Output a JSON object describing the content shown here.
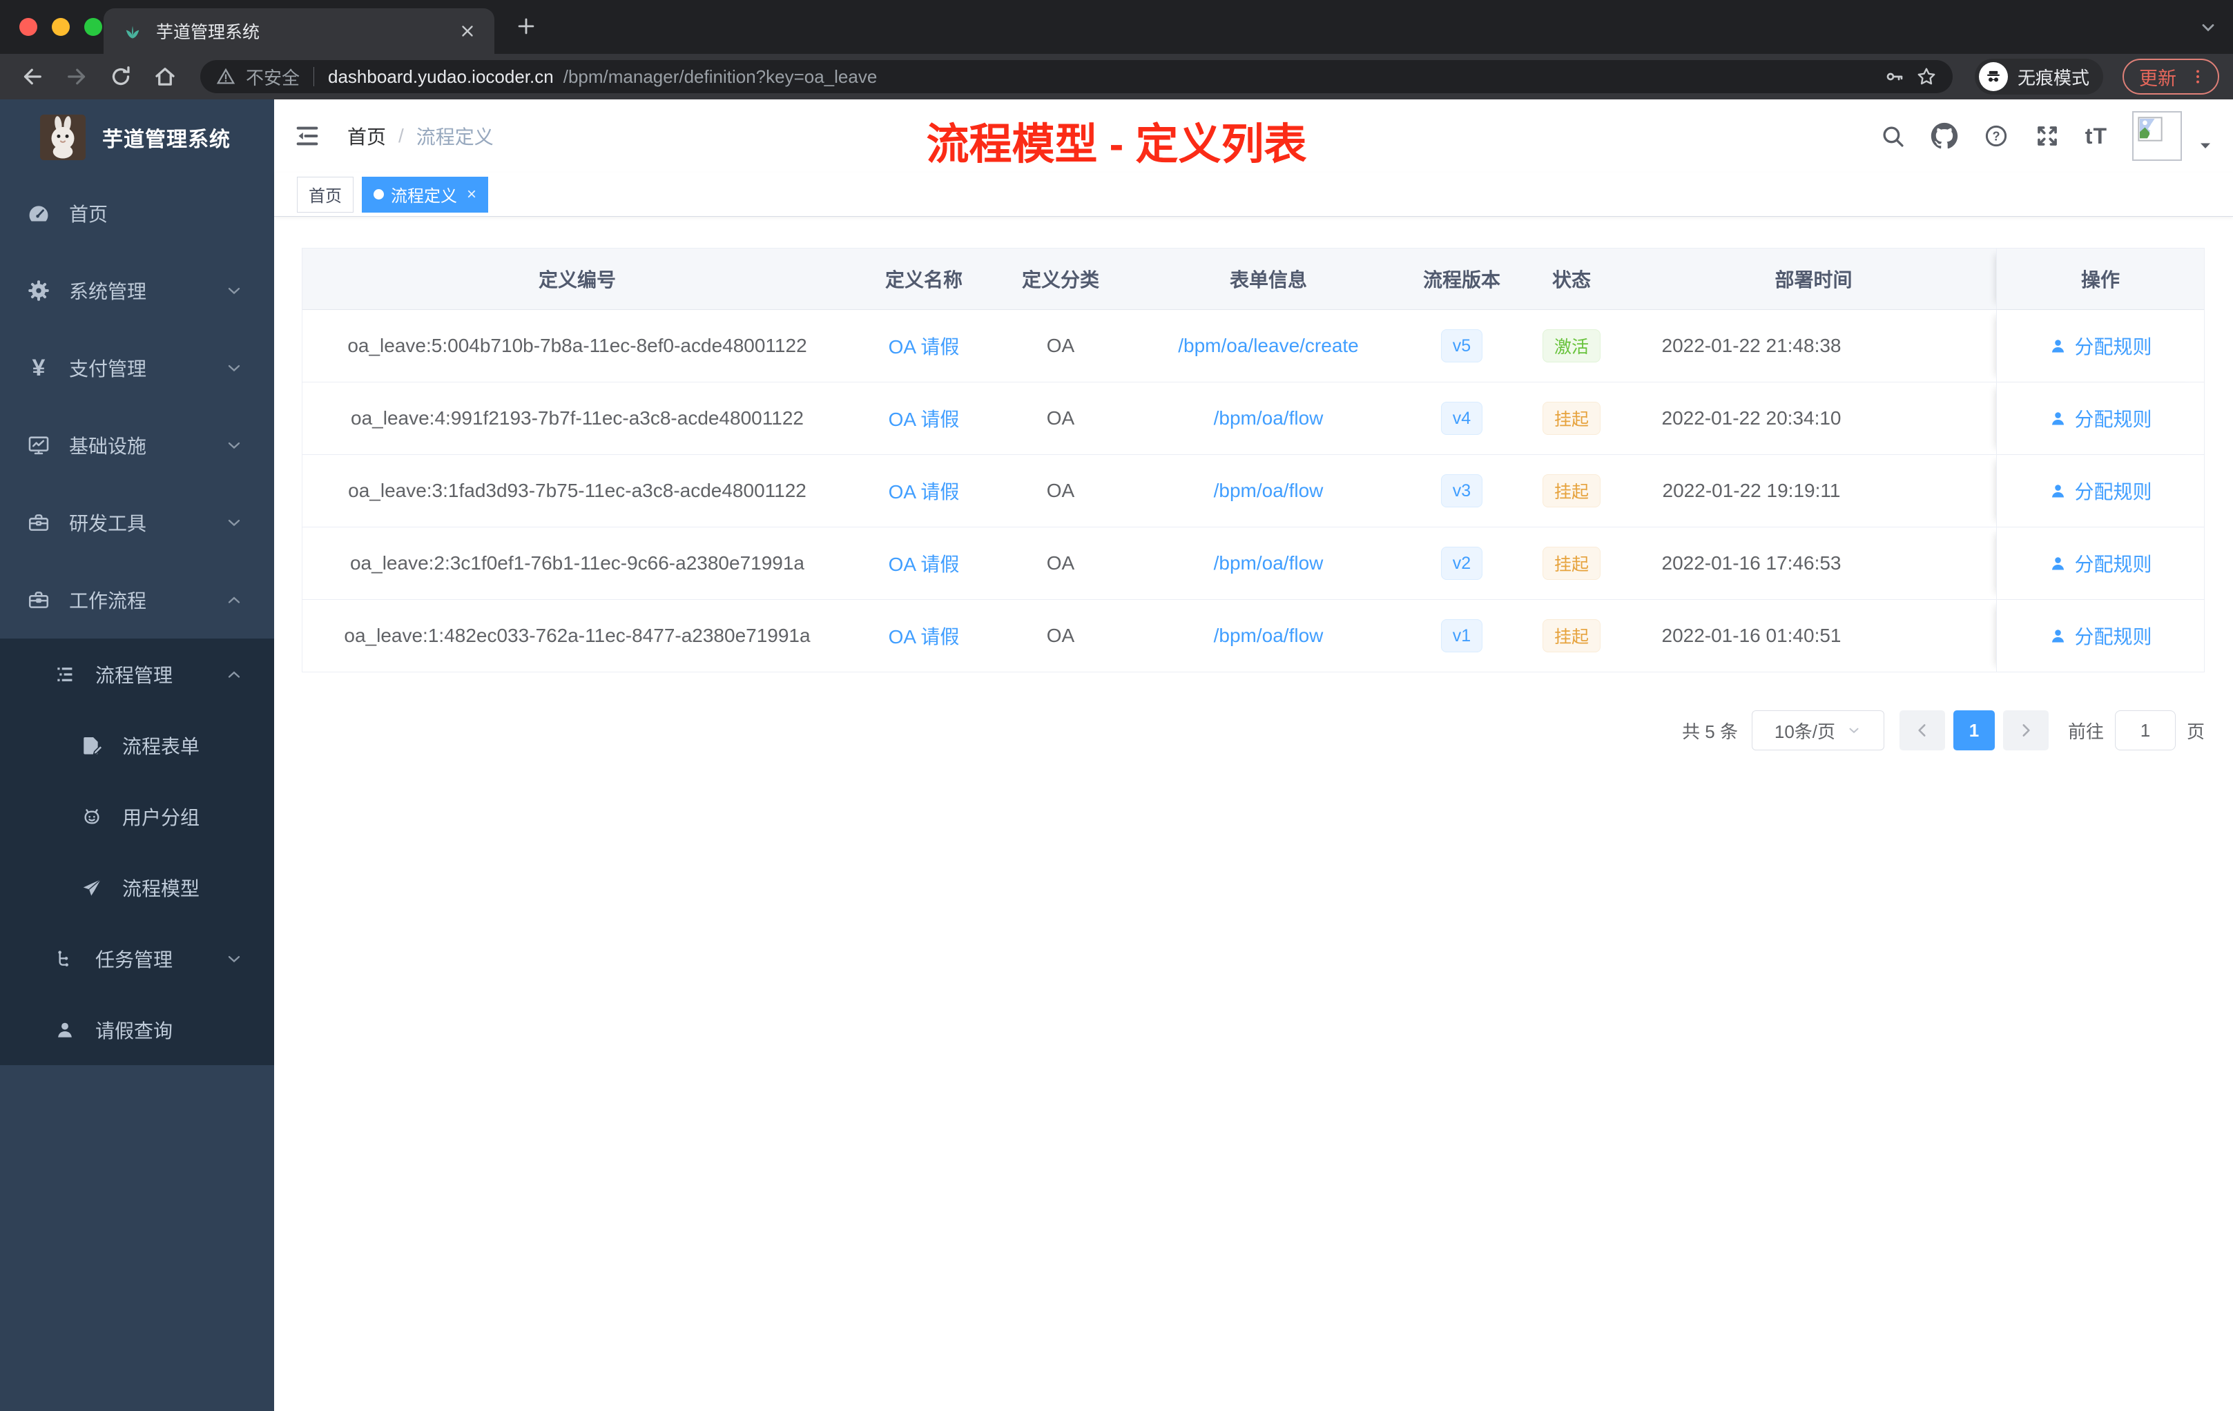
{
  "browser": {
    "tab": {
      "title": "芋道管理系统",
      "favicon": "sprout-icon"
    },
    "address": {
      "security_label": "不安全",
      "domain": "dashboard.yudao.iocoder.cn",
      "path": "/bpm/manager/definition?key=oa_leave"
    },
    "incognito_label": "无痕模式",
    "update_label": "更新"
  },
  "sidebar": {
    "logo_title": "芋道管理系统",
    "menu": [
      {
        "label": "首页",
        "icon": "dashboard-icon",
        "level": 1
      },
      {
        "label": "系统管理",
        "icon": "gear-icon",
        "level": 1,
        "arrow": "down"
      },
      {
        "label": "支付管理",
        "icon": "yen-icon",
        "level": 1,
        "arrow": "down"
      },
      {
        "label": "基础设施",
        "icon": "monitor-icon",
        "level": 1,
        "arrow": "down"
      },
      {
        "label": "研发工具",
        "icon": "toolbox-icon",
        "level": 1,
        "arrow": "down"
      },
      {
        "label": "工作流程",
        "icon": "briefcase-icon",
        "level": 1,
        "arrow": "up"
      },
      {
        "label": "流程管理",
        "icon": "list-tree-icon",
        "level": 2,
        "arrow": "up"
      },
      {
        "label": "流程表单",
        "icon": "form-icon",
        "level": 3
      },
      {
        "label": "用户分组",
        "icon": "robot-icon",
        "level": 3
      },
      {
        "label": "流程模型",
        "icon": "paper-plane-icon",
        "level": 3
      },
      {
        "label": "任务管理",
        "icon": "tree-icon",
        "level": 2,
        "arrow": "down"
      },
      {
        "label": "请假查询",
        "icon": "user-icon",
        "level": 2
      }
    ]
  },
  "header": {
    "breadcrumb_home": "首页",
    "breadcrumb_current": "流程定义",
    "annotation": "流程模型 - 定义列表"
  },
  "tags": {
    "home": "首页",
    "active": "流程定义"
  },
  "table": {
    "columns": {
      "id": "定义编号",
      "name": "定义名称",
      "category": "定义分类",
      "form": "表单信息",
      "version": "流程版本",
      "status": "状态",
      "deploy_time": "部署时间",
      "actions": "操作"
    },
    "rows": [
      {
        "id": "oa_leave:5:004b710b-7b8a-11ec-8ef0-acde48001122",
        "name": "OA 请假",
        "category": "OA",
        "form": "/bpm/oa/leave/create",
        "version": "v5",
        "status": "激活",
        "deploy_time": "2022-01-22 21:48:38",
        "action": "分配规则"
      },
      {
        "id": "oa_leave:4:991f2193-7b7f-11ec-a3c8-acde48001122",
        "name": "OA 请假",
        "category": "OA",
        "form": "/bpm/oa/flow",
        "version": "v4",
        "status": "挂起",
        "deploy_time": "2022-01-22 20:34:10",
        "action": "分配规则"
      },
      {
        "id": "oa_leave:3:1fad3d93-7b75-11ec-a3c8-acde48001122",
        "name": "OA 请假",
        "category": "OA",
        "form": "/bpm/oa/flow",
        "version": "v3",
        "status": "挂起",
        "deploy_time": "2022-01-22 19:19:11",
        "action": "分配规则"
      },
      {
        "id": "oa_leave:2:3c1f0ef1-76b1-11ec-9c66-a2380e71991a",
        "name": "OA 请假",
        "category": "OA",
        "form": "/bpm/oa/flow",
        "version": "v2",
        "status": "挂起",
        "deploy_time": "2022-01-16 17:46:53",
        "action": "分配规则"
      },
      {
        "id": "oa_leave:1:482ec033-762a-11ec-8477-a2380e71991a",
        "name": "OA 请假",
        "category": "OA",
        "form": "/bpm/oa/flow",
        "version": "v1",
        "status": "挂起",
        "deploy_time": "2022-01-16 01:40:51",
        "action": "分配规则"
      }
    ]
  },
  "pagination": {
    "total": "共 5 条",
    "page_size": "10条/页",
    "current_page": "1",
    "goto_label": "前往",
    "goto_value": "1",
    "page_suffix": "页"
  },
  "colors": {
    "primary": "#409eff",
    "success": "#67c23a",
    "warning": "#e6a23c",
    "sidebar_bg": "#304156",
    "submenu_bg": "#1f2d3d",
    "annotation_red": "#fb2b16"
  }
}
